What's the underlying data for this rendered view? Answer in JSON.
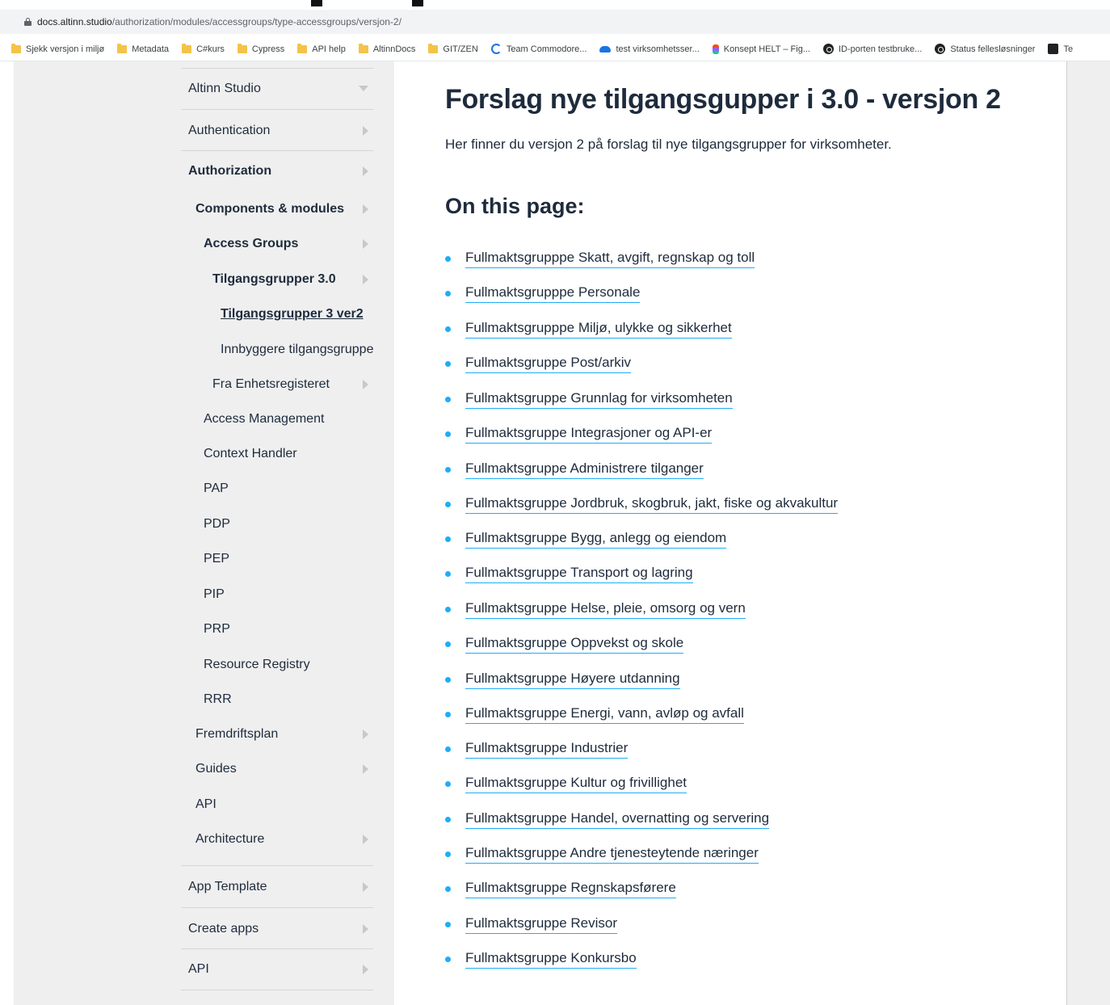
{
  "browser": {
    "url_host": "docs.altinn.studio",
    "url_path": "/authorization/modules/accessgroups/type-accessgroups/versjon-2/"
  },
  "bookmarks": [
    {
      "label": "Sjekk versjon i miljø",
      "icon": "folder-icon"
    },
    {
      "label": "Metadata",
      "icon": "folder-icon"
    },
    {
      "label": "C#kurs",
      "icon": "folder-icon"
    },
    {
      "label": "Cypress",
      "icon": "folder-icon"
    },
    {
      "label": "API help",
      "icon": "folder-icon"
    },
    {
      "label": "AltinnDocs",
      "icon": "folder-icon"
    },
    {
      "label": "GIT/ZEN",
      "icon": "folder-icon"
    },
    {
      "label": "Team Commodore...",
      "icon": "refresh-icon"
    },
    {
      "label": "test virksomhetsser...",
      "icon": "cloud-icon"
    },
    {
      "label": "Konsept HELT – Fig...",
      "icon": "figma-icon"
    },
    {
      "label": "ID-porten testbruke...",
      "icon": "circle-icon"
    },
    {
      "label": "Status fellesløsninger",
      "icon": "circle-icon"
    },
    {
      "label": "Te",
      "icon": "box-icon"
    }
  ],
  "sidebar": {
    "items": [
      {
        "label": "Altinn Studio"
      },
      {
        "label": "Authentication"
      },
      {
        "label": "Authorization"
      },
      {
        "label": "Components & modules"
      },
      {
        "label": "Access Groups"
      },
      {
        "label": "Tilgangsgrupper 3.0"
      },
      {
        "label": "Tilgangsgrupper 3 ver2"
      },
      {
        "label": "Innbyggere tilgangsgrupper"
      },
      {
        "label": "Fra Enhetsregisteret"
      },
      {
        "label": "Access Management"
      },
      {
        "label": "Context Handler"
      },
      {
        "label": "PAP"
      },
      {
        "label": "PDP"
      },
      {
        "label": "PEP"
      },
      {
        "label": "PIP"
      },
      {
        "label": "PRP"
      },
      {
        "label": "Resource Registry"
      },
      {
        "label": "RRR"
      },
      {
        "label": "Fremdriftsplan"
      },
      {
        "label": "Guides"
      },
      {
        "label": "API"
      },
      {
        "label": "Architecture"
      },
      {
        "label": "App Template"
      },
      {
        "label": "Create apps"
      },
      {
        "label": "API"
      }
    ]
  },
  "main": {
    "title": "Forslag nye tilgangsgupper i 3.0 - versjon 2",
    "intro": "Her finner du versjon 2 på forslag til nye tilgangsgrupper for virksomheter.",
    "toc_heading": "On this page:",
    "toc": [
      "Fullmaktsgrupppe Skatt, avgift, regnskap og toll",
      "Fullmaktsgrupppe Personale",
      "Fullmaktsgrupppe Miljø, ulykke og sikkerhet",
      "Fullmaktsgruppe Post/arkiv",
      "Fullmaktsgruppe Grunnlag for virksomheten",
      "Fullmaktsgruppe Integrasjoner og API-er",
      "Fullmaktsgruppe Administrere tilganger",
      "Fullmaktsgruppe Jordbruk, skogbruk, jakt, fiske og akvakultur",
      "Fullmaktsgruppe Bygg, anlegg og eiendom",
      "Fullmaktsgruppe Transport og lagring",
      "Fullmaktsgruppe Helse, pleie, omsorg og vern",
      "Fullmaktsgruppe Oppvekst og skole",
      "Fullmaktsgruppe Høyere utdanning",
      "Fullmaktsgruppe Energi, vann, avløp og avfall",
      "Fullmaktsgruppe Industrier",
      "Fullmaktsgruppe Kultur og frivillighet",
      "Fullmaktsgruppe Handel, overnatting og servering",
      "Fullmaktsgruppe Andre tjenesteytende næringer",
      "Fullmaktsgruppe Regnskapsførere",
      "Fullmaktsgruppe Revisor",
      "Fullmaktsgruppe Konkursbo"
    ]
  },
  "colors": {
    "accent": "#1eadf7",
    "text": "#1e2b3c",
    "sidebar_bg": "#efefef"
  }
}
